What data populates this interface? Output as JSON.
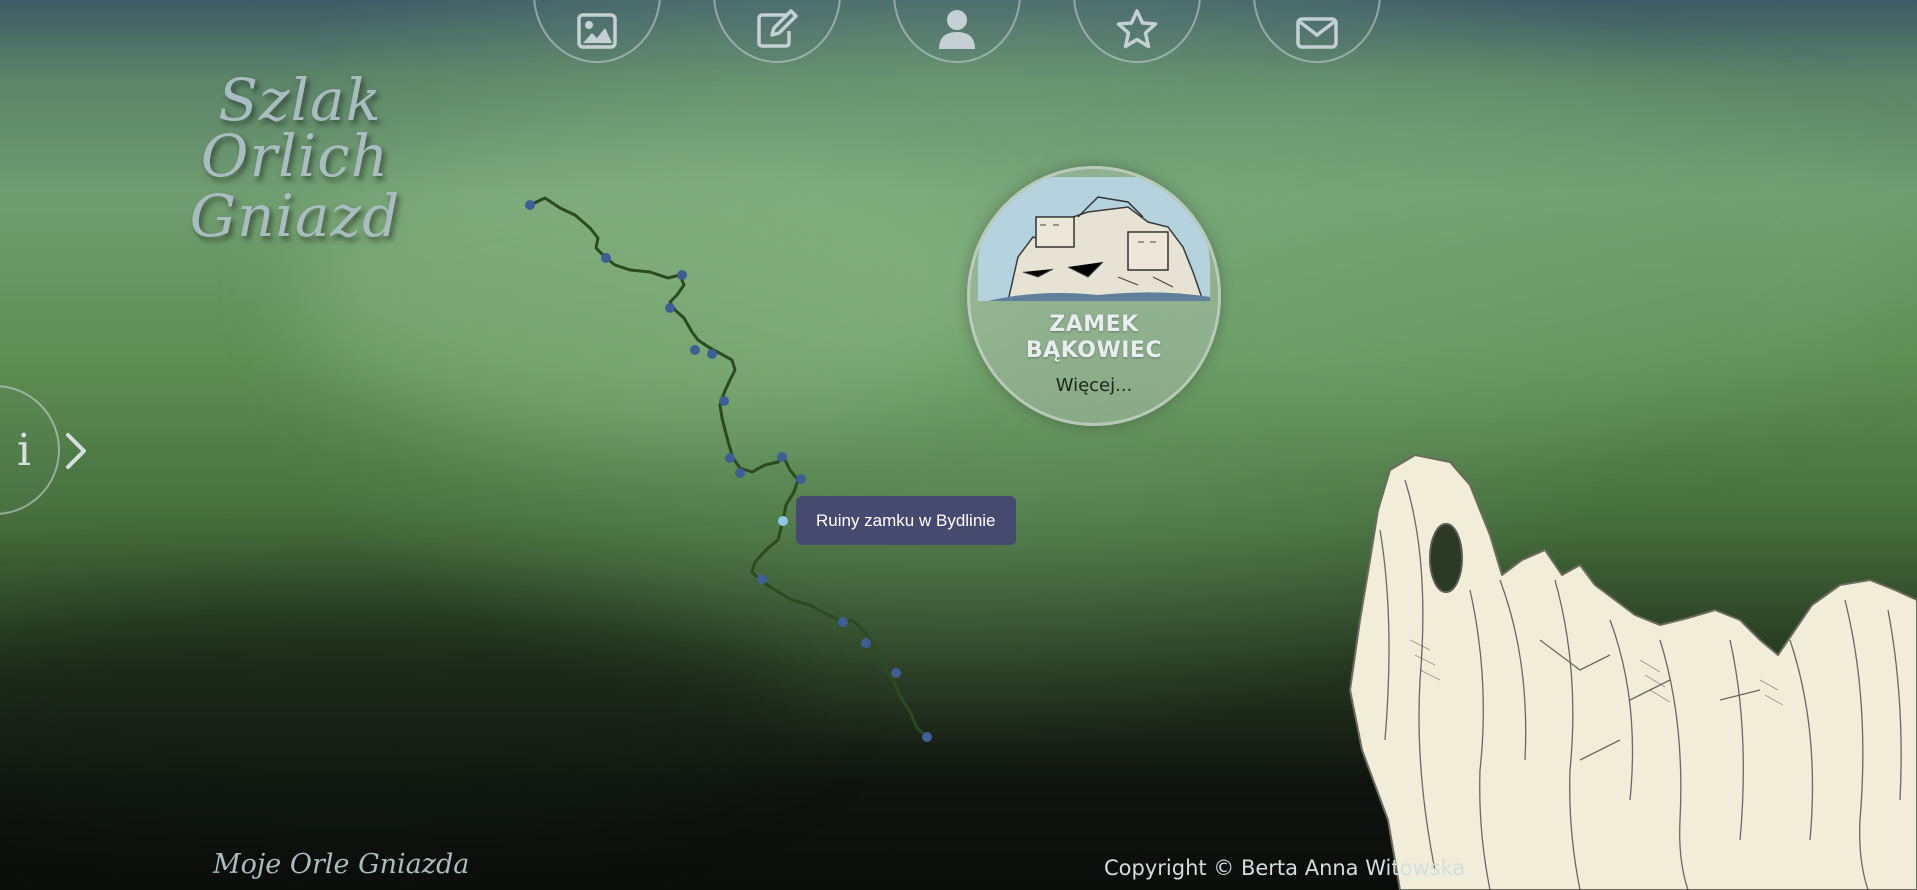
{
  "nav": {
    "items": [
      {
        "icon": "image-icon"
      },
      {
        "icon": "edit-icon"
      },
      {
        "icon": "user-icon"
      },
      {
        "icon": "star-icon"
      },
      {
        "icon": "envelope-icon"
      }
    ],
    "icon_color": "#c4d0d3"
  },
  "logo": {
    "line1": "Szlak",
    "line2": "Orlich Gniazd"
  },
  "info": {
    "letter": "i",
    "icon": "chevron-right-icon"
  },
  "poi": {
    "title_line1": "ZAMEK",
    "title_line2": "BĄKOWIEC",
    "more": "Więcej..."
  },
  "map": {
    "trail_color": "#2c4a1f",
    "marker_color": "#3d5f96",
    "active_marker_color": "#8fc7e6",
    "tooltip": "Ruiny zamku w Bydlinie"
  },
  "footer": {
    "left": "Moje Orle Gniazda",
    "copyright": "Copyright © Berta Anna Witowska"
  }
}
